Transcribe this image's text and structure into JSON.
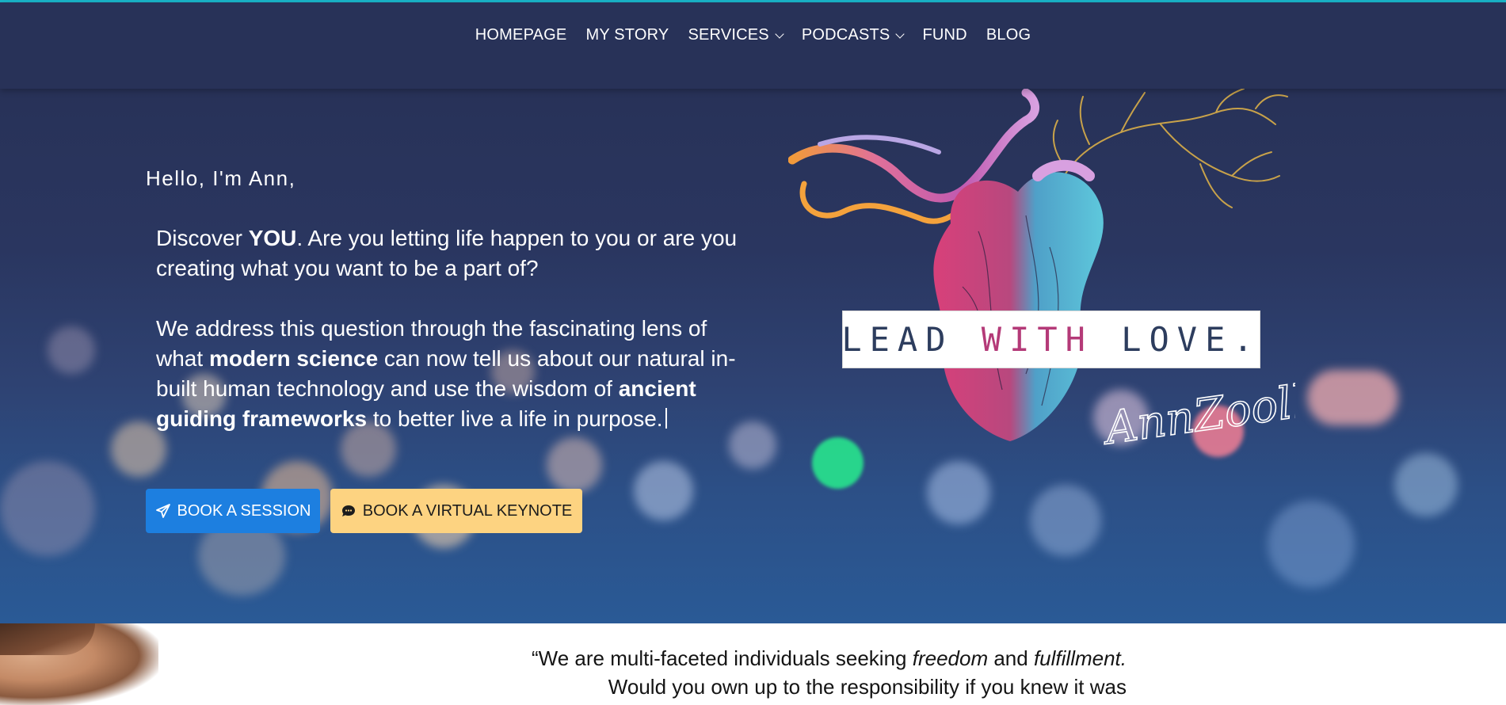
{
  "nav": {
    "items": [
      {
        "label": "HOMEPAGE",
        "dropdown": false
      },
      {
        "label": "MY STORY",
        "dropdown": false
      },
      {
        "label": "SERVICES",
        "dropdown": true
      },
      {
        "label": "PODCASTS",
        "dropdown": true
      },
      {
        "label": "FUND",
        "dropdown": false
      },
      {
        "label": "BLOG",
        "dropdown": false
      }
    ]
  },
  "hero": {
    "greeting": "Hello, I'm Ann,",
    "p1": {
      "pre": "Discover ",
      "bold": "YOU",
      "post": ". Are you letting life happen to you or are you creating what you want to be a part of?"
    },
    "p2": {
      "t1": "We address this question through the fascinating lens of what ",
      "b1": "modern science",
      "t2": " can now tell us about our natural in-built human technology and use the wisdom of ",
      "b2": "ancient guiding frameworks",
      "t3": " to better live a life in purpose."
    },
    "art": {
      "banner_left": "LEAD ",
      "banner_pink": "WITH",
      "banner_right": " LOVE.",
      "signature": "AnnZoolhelle"
    },
    "buttons": {
      "session": {
        "label": "BOOK A SESSION",
        "icon": "paper-plane-icon"
      },
      "keynote": {
        "label": "BOOK A VIRTUAL KEYNOTE",
        "icon": "comment-dots-icon"
      }
    }
  },
  "quote": {
    "t1": "“We are multi-faceted individuals seeking ",
    "i1": "freedom",
    "t2": " and ",
    "i2": "fulfillment.",
    "line2": "Would you own up to the responsibility if you knew it was"
  },
  "colors": {
    "accent_strip": "#19b5c9",
    "nav_bg": "#283258",
    "session_button": "#1d7fe0",
    "keynote_button": "#fdd381"
  }
}
